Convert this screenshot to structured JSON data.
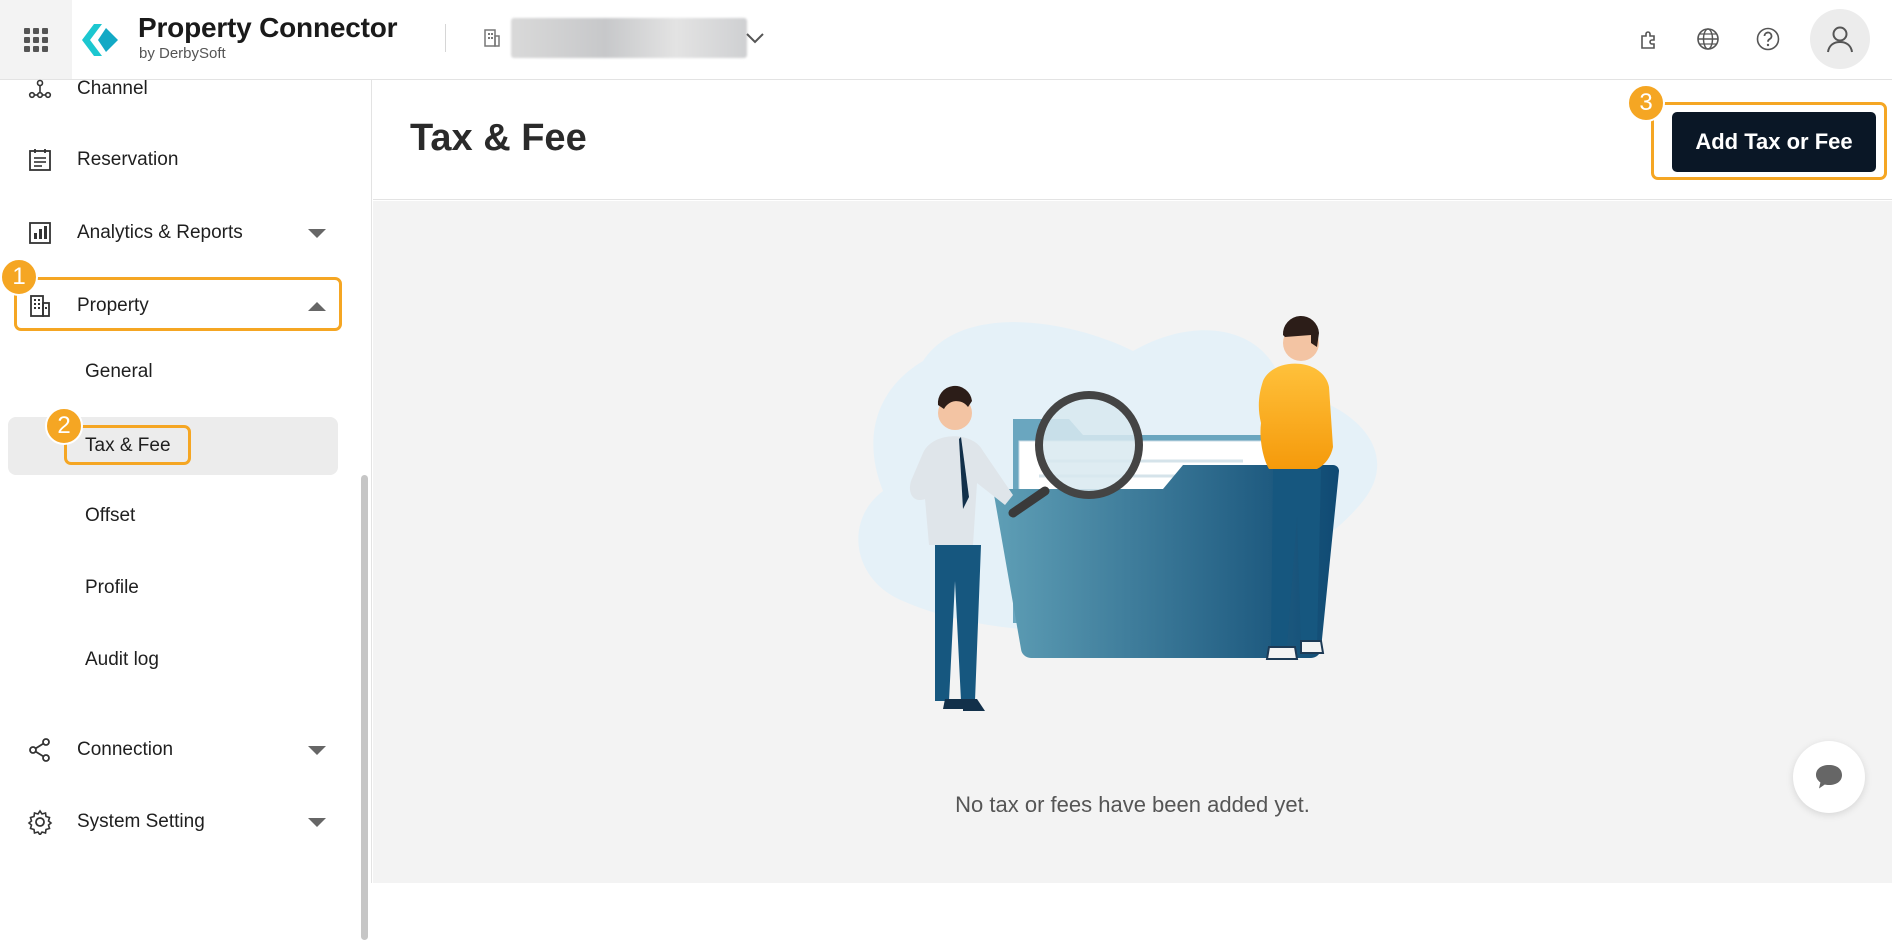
{
  "header": {
    "app_title": "Property Connector",
    "app_subtitle": "by DerbySoft"
  },
  "sidebar": {
    "items": [
      {
        "label": "Channel",
        "icon": "channel-icon"
      },
      {
        "label": "Reservation",
        "icon": "calendar-icon"
      },
      {
        "label": "Analytics & Reports",
        "icon": "chart-icon",
        "expanded": false
      },
      {
        "label": "Property",
        "icon": "building-icon",
        "expanded": true
      },
      {
        "label": "Connection",
        "icon": "share-icon",
        "expanded": false
      },
      {
        "label": "System Setting",
        "icon": "gear-icon",
        "expanded": false
      }
    ],
    "property_sub": [
      {
        "label": "General"
      },
      {
        "label": "Tax & Fee",
        "active": true
      },
      {
        "label": "Offset"
      },
      {
        "label": "Profile"
      },
      {
        "label": "Audit log"
      }
    ]
  },
  "annotations": {
    "step1": "1",
    "step2": "2",
    "step3": "3",
    "highlight_color": "#f5a623"
  },
  "main": {
    "title": "Tax & Fee",
    "add_button": "Add Tax or Fee",
    "empty_message": "No tax or fees have been added yet."
  },
  "colors": {
    "brand_accent": "#1cc7d0",
    "primary_button": "#0a1726"
  }
}
